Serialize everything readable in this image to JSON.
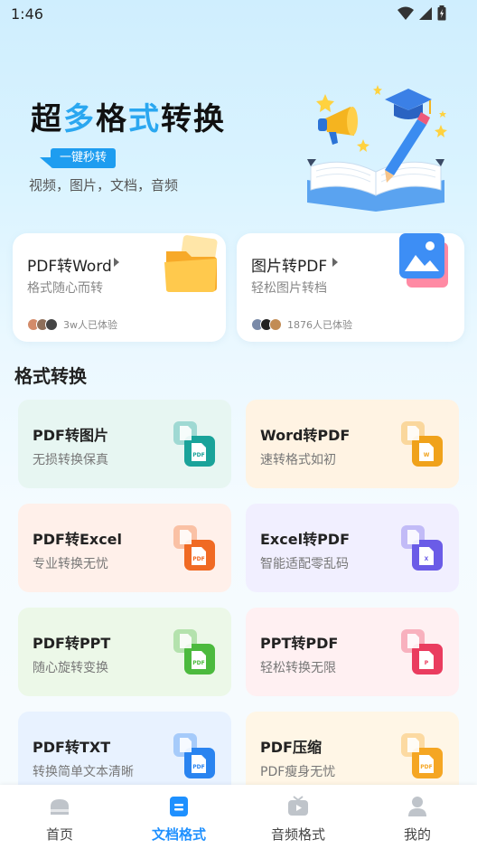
{
  "status": {
    "time": "1:46"
  },
  "hero": {
    "title_part1": "超",
    "title_part2": "多",
    "title_part3": "格",
    "title_part4": "式",
    "title_part5": "转换",
    "badge": "一键秒转",
    "subtitle": "视频，图片，文档，音频"
  },
  "features": [
    {
      "title": "PDF转Word",
      "subtitle": "格式随心而转",
      "users": "3w人已体验",
      "icon": "folder-icon"
    },
    {
      "title": "图片转PDF",
      "subtitle": "轻松图片转档",
      "users": "1876人已体验",
      "icon": "image-icon"
    }
  ],
  "section": {
    "title": "格式转换"
  },
  "cards": [
    {
      "title": "PDF转图片",
      "subtitle": "无损转换保真",
      "bg": "#e7f6f2",
      "accent": "#1aa39a",
      "label": "PDF"
    },
    {
      "title": "Word转PDF",
      "subtitle": "速转格式如初",
      "bg": "#fff3e3",
      "accent": "#f0a21b",
      "label": "W"
    },
    {
      "title": "PDF转Excel",
      "subtitle": "专业转换无忧",
      "bg": "#fff0ea",
      "accent": "#f06a24",
      "label": "PDF"
    },
    {
      "title": "Excel转PDF",
      "subtitle": "智能适配零乱码",
      "bg": "#f1efff",
      "accent": "#6b5ce7",
      "label": "X"
    },
    {
      "title": "PDF转PPT",
      "subtitle": "随心旋转变换",
      "bg": "#ecf8e8",
      "accent": "#4cba3e",
      "label": "PDF"
    },
    {
      "title": "PPT转PDF",
      "subtitle": "轻松转换无限",
      "bg": "#fff0f2",
      "accent": "#ea3c5f",
      "label": "P"
    },
    {
      "title": "PDF转TXT",
      "subtitle": "转换简单文本清晰",
      "bg": "#e8f2ff",
      "accent": "#2a84f0",
      "label": "PDF"
    },
    {
      "title": "PDF压缩",
      "subtitle": "PDF瘦身无忧",
      "bg": "#fff6e6",
      "accent": "#f5a623",
      "label": "PDF"
    }
  ],
  "nav": [
    {
      "label": "首页",
      "icon": "home-icon",
      "active": false
    },
    {
      "label": "文档格式",
      "icon": "document-icon",
      "active": true
    },
    {
      "label": "音频格式",
      "icon": "media-icon",
      "active": false
    },
    {
      "label": "我的",
      "icon": "profile-icon",
      "active": false
    }
  ]
}
